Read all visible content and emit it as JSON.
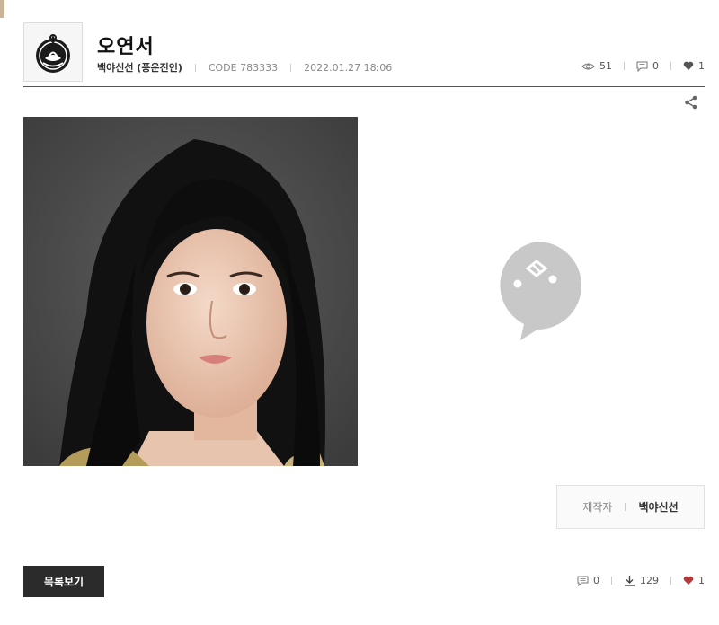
{
  "post": {
    "title": "오연서",
    "author": "백야신선 (풍운진인)",
    "code": "CODE 783333",
    "date": "2022.01.27 18:06"
  },
  "stats_top": {
    "views": "51",
    "comments": "0",
    "likes": "1"
  },
  "creator": {
    "label": "제작자",
    "name": "백야신선"
  },
  "buttons": {
    "list_label": "목록보기"
  },
  "stats_bottom": {
    "comments": "0",
    "downloads": "129",
    "likes": "1"
  },
  "colors": {
    "accent": "#c9b49a",
    "like": "#b33a3a",
    "dark_button": "#2b2b2b",
    "placeholder_bubble": "#c8c8c8"
  },
  "icons": [
    "logo-emblem-icon",
    "eye-icon",
    "comment-icon",
    "heart-icon",
    "share-icon",
    "download-icon",
    "speech-bubble-placeholder-icon"
  ]
}
